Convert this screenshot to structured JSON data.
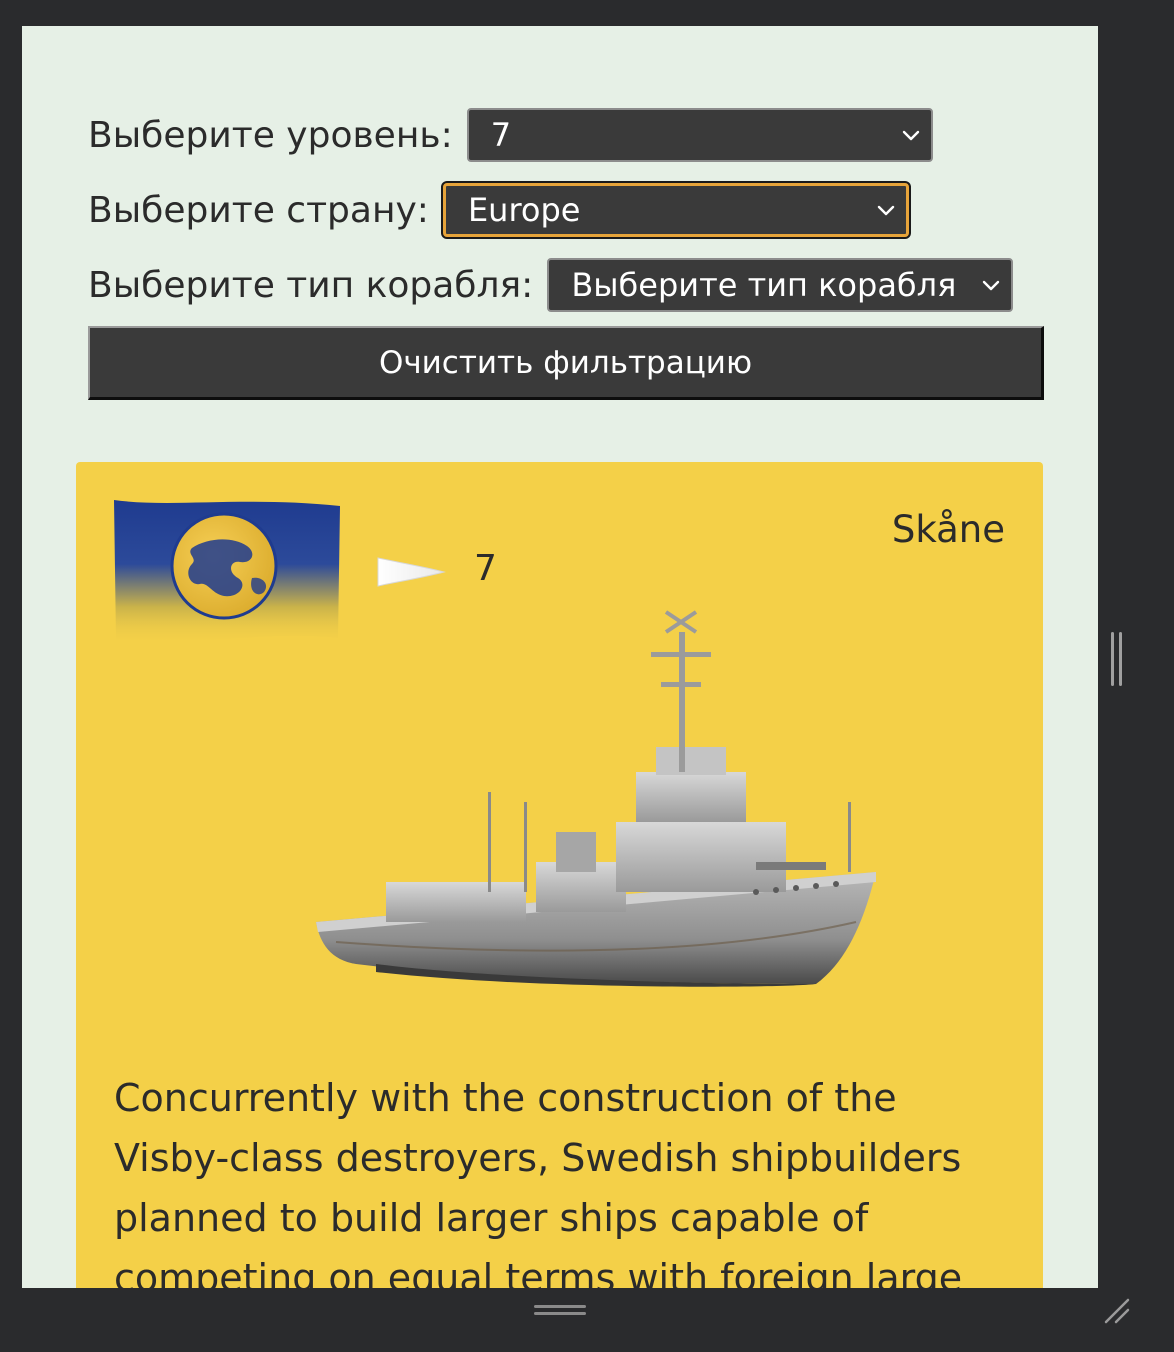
{
  "filters": {
    "level": {
      "label": "Выберите уровень:",
      "value": "7"
    },
    "country": {
      "label": "Выберите страну:",
      "value": "Europe"
    },
    "ship_type": {
      "label": "Выберите тип корабля:",
      "value": "Выберите тип корабля"
    },
    "clear_label": "Очистить фильтрацию"
  },
  "card": {
    "ship_name": "Skåne",
    "tier": "7",
    "flag_icon": "europe-flag-icon",
    "tier_icon": "tier-pennant-icon",
    "description": "Concurrently with the construction of the Visby-class destroyers, Swedish shipbuilders planned to build larger ships capable of competing on equal terms with foreign large destroyers. The"
  },
  "colors": {
    "page_bg": "#e6f0e6",
    "card_bg": "#f4d048",
    "control_bg": "#3a3a3a",
    "focus_ring": "#e7a43a",
    "window_bg": "#2a2b2d"
  }
}
